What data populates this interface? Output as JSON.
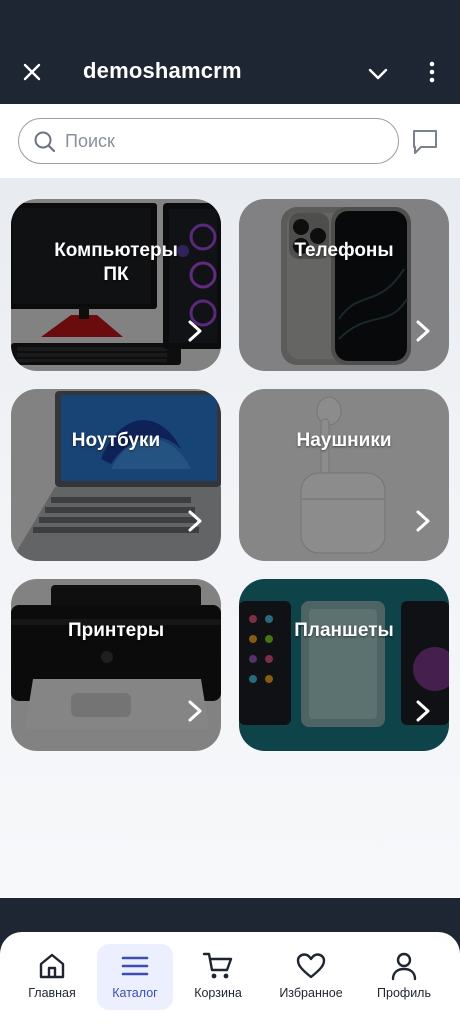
{
  "header": {
    "title": "demoshamcrm",
    "close_icon": "close-icon",
    "chevron_icon": "chevron-down-icon",
    "more_icon": "more-vertical-icon",
    "background_color": "#1f2633"
  },
  "search": {
    "placeholder": "Поиск",
    "value": "",
    "icon": "search-icon",
    "chat_icon": "chat-icon"
  },
  "categories": [
    {
      "label": "Компьютеры ПК",
      "line1": "Компьютеры",
      "line2": "ПК",
      "image": "desktop-pc"
    },
    {
      "label": "Телефоны",
      "image": "smartphone"
    },
    {
      "label": "Ноутбуки",
      "image": "laptop"
    },
    {
      "label": "Наушники",
      "image": "earbuds"
    },
    {
      "label": "Принтеры",
      "image": "printer"
    },
    {
      "label": "Планшеты",
      "image": "tablet"
    }
  ],
  "bottom_nav": {
    "active": "Каталог",
    "accent_color": "#3d4db6",
    "items": [
      {
        "label": "Главная",
        "icon": "home-icon"
      },
      {
        "label": "Каталог",
        "icon": "menu-icon"
      },
      {
        "label": "Корзина",
        "icon": "cart-icon"
      },
      {
        "label": "Избранное",
        "icon": "heart-icon"
      },
      {
        "label": "Профиль",
        "icon": "user-icon"
      }
    ]
  }
}
